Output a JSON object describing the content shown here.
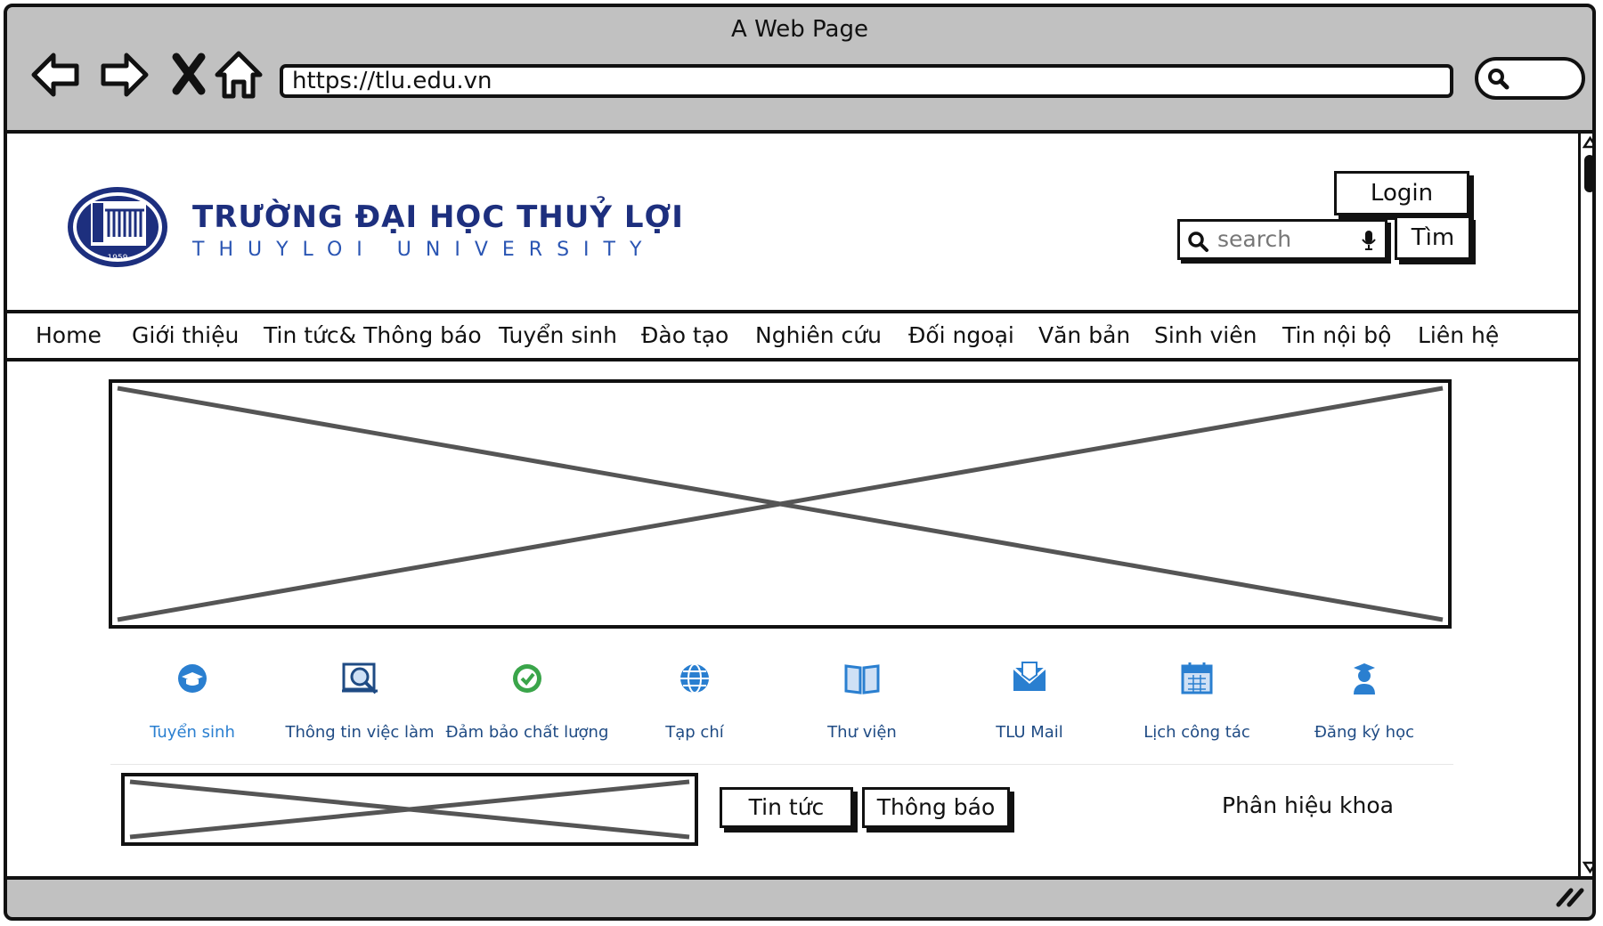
{
  "window": {
    "title": "A Web Page"
  },
  "browser": {
    "url": "https://tlu.edu.vn",
    "icons": [
      "back-arrow-icon",
      "forward-arrow-icon",
      "close-icon",
      "home-icon",
      "search-icon"
    ]
  },
  "header": {
    "logo_title": "TRƯỜNG ĐẠI HỌC THUỶ LỢI",
    "logo_subtitle": "THUYLOI UNIVERSITY",
    "logo_year": "1959",
    "login_label": "Login",
    "search_placeholder": "search",
    "search_button": "Tìm"
  },
  "menu": {
    "items": [
      "Home",
      "Giới thiệu",
      "Tin tức& Thông báo",
      "Tuyển sinh",
      "Đào tạo",
      "Nghiên cứu",
      "Đối ngoại",
      "Văn bản",
      "Sinh viên",
      "Tin nội bộ",
      "Liên hệ"
    ]
  },
  "quick_links": [
    {
      "label": "Tuyển sinh",
      "icon": "graduation-cap-icon"
    },
    {
      "label": "Thông tin việc làm",
      "icon": "job-search-icon"
    },
    {
      "label": "Đảm bảo chất lượng",
      "icon": "quality-check-icon"
    },
    {
      "label": "Tạp chí",
      "icon": "globe-www-icon"
    },
    {
      "label": "Thư viện",
      "icon": "book-icon"
    },
    {
      "label": "TLU Mail",
      "icon": "mail-icon"
    },
    {
      "label": "Lịch công tác",
      "icon": "calendar-icon"
    },
    {
      "label": "Đăng ký học",
      "icon": "student-icon"
    }
  ],
  "content": {
    "tab_news": "Tin tức",
    "tab_announcements": "Thông báo",
    "branch_label": "Phân hiệu khoa"
  },
  "colors": {
    "brand_navy": "#1d2f7e",
    "link_blue": "#1f4b84",
    "accent_blue": "#2a7fd0",
    "chrome_gray": "#c1c1c1"
  }
}
